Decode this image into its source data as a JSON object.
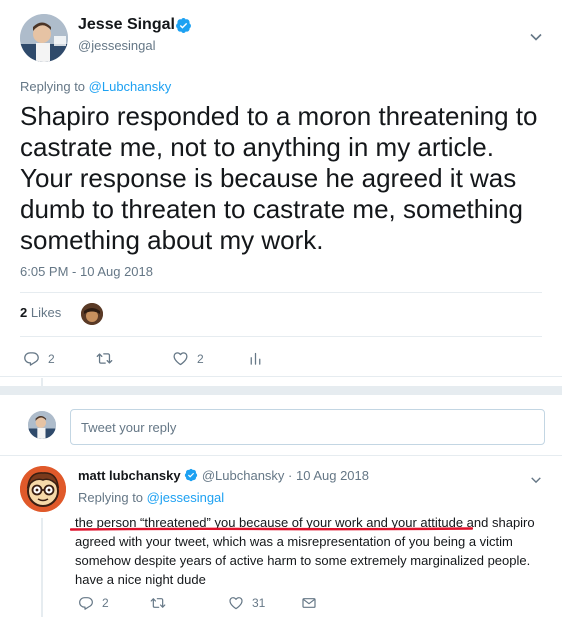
{
  "main_tweet": {
    "author_name": "Jesse Singal",
    "author_handle": "@jessesingal",
    "replying_prefix": "Replying to ",
    "replying_to": "@Lubchansky",
    "text": "Shapiro responded to a moron threatening to castrate me, not to anything in my article. Your response is because he agreed it was dumb to threaten to castrate me, something something about my work.",
    "timestamp": "6:05 PM - 10 Aug 2018",
    "likes_count": "2",
    "likes_label": "Likes",
    "actions": {
      "reply_count": "2",
      "retweet_count": "",
      "like_count": "2"
    }
  },
  "composer": {
    "placeholder": "Tweet your reply"
  },
  "reply_tweet": {
    "author_name": "matt lubchansky",
    "author_handle": "@Lubchansky",
    "separator": " · ",
    "date": "10 Aug 2018",
    "replying_prefix": "Replying to ",
    "replying_to": "@jessesingal",
    "text": "the person “threatened” you because of your work and your attitude and shapiro agreed with your tweet, which was a misrepresentation of you being a victim somehow despite years of active harm to some extremely marginalized people. have a nice night dude",
    "actions": {
      "reply_count": "2",
      "retweet_count": "",
      "like_count": "31"
    }
  },
  "colors": {
    "accent": "#1da1f2",
    "secondary_text": "#657786",
    "primary_text": "#14171a",
    "divider": "#e6ecf0",
    "annotation_red": "#e0112b"
  }
}
